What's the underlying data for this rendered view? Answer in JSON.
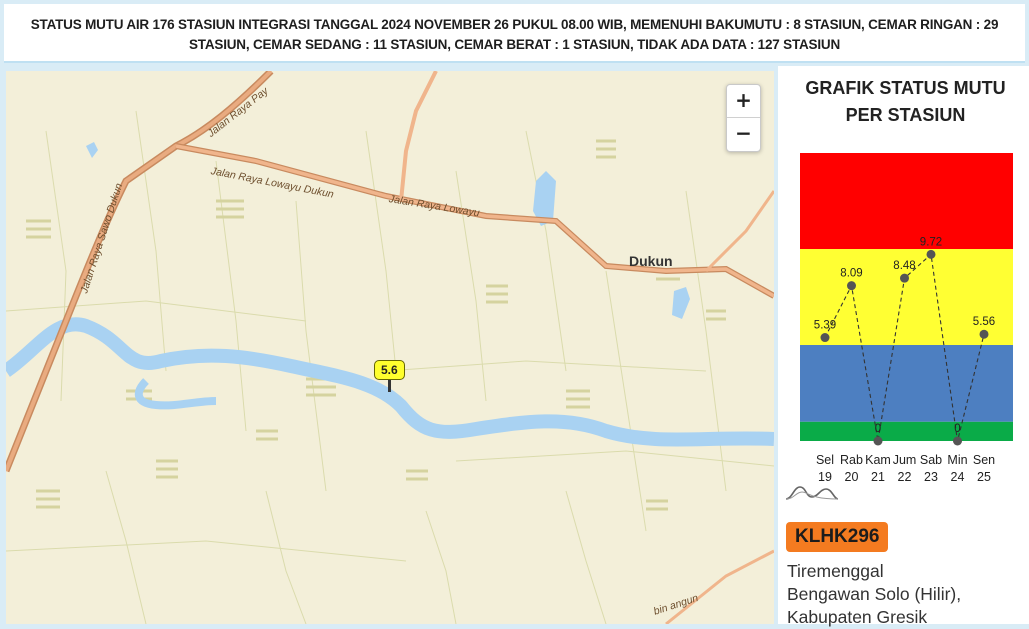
{
  "banner": {
    "text": "STATUS MUTU AIR 176 STASIUN INTEGRASI TANGGAL 2024 NOVEMBER 26 PUKUL 08.00 WIB, MEMENUHI BAKUMUTU : 8 STASIUN, CEMAR RINGAN : 29 STASIUN, CEMAR SEDANG : 11 STASIUN, CEMAR BERAT : 1 STASIUN, TIDAK ADA DATA : 127 STASIUN"
  },
  "map": {
    "zoom_in": "+",
    "zoom_out": "−",
    "town": "Dukun",
    "roads": {
      "sawo_dukun": "Jalan Raya Sawo Dukun",
      "lowayu_dukun": "Jalan Raya Lowayu Dukun",
      "lowayu": "Jalan Raya Lowayu",
      "pay": "Jalan Raya Pay",
      "bottom": "bin angun"
    },
    "marker_value": "5.6",
    "marker_color": "#ffff2e"
  },
  "panel": {
    "title": "GRAFIK STATUS MUTU PER STASIUN",
    "station_id": "KLHK296",
    "station_color": "#f47b20",
    "station_desc_1": "Tiremenggal",
    "station_desc_2": "Bengawan Solo (Hilir),",
    "station_desc_3": "Kabupaten Gresik",
    "wave_icon": "wave-chart-icon"
  },
  "chart_data": {
    "type": "line",
    "categories": [
      "Sel 19",
      "Rab 20",
      "Kam 21",
      "Jum 22",
      "Sab 23",
      "Min 24",
      "Sen 25"
    ],
    "day_labels": [
      "Sel",
      "Rab",
      "Kam",
      "Jum",
      "Sab",
      "Min",
      "Sen"
    ],
    "date_labels": [
      "19",
      "20",
      "21",
      "22",
      "23",
      "24",
      "25"
    ],
    "values": [
      5.39,
      8.09,
      0,
      8.48,
      9.72,
      0,
      5.56
    ],
    "value_labels": [
      "5.39",
      "8.09",
      "0",
      "8.48",
      "9.72",
      "0",
      "5.56"
    ],
    "ylim": [
      0,
      15
    ],
    "bands": [
      {
        "from": 10,
        "to": 15,
        "color": "#ff0000"
      },
      {
        "from": 5,
        "to": 10,
        "color": "#ffff33"
      },
      {
        "from": 1,
        "to": 5,
        "color": "#4d7fc1"
      },
      {
        "from": 0,
        "to": 1,
        "color": "#0aab48"
      }
    ],
    "line_style": "dashed",
    "grid": false
  }
}
